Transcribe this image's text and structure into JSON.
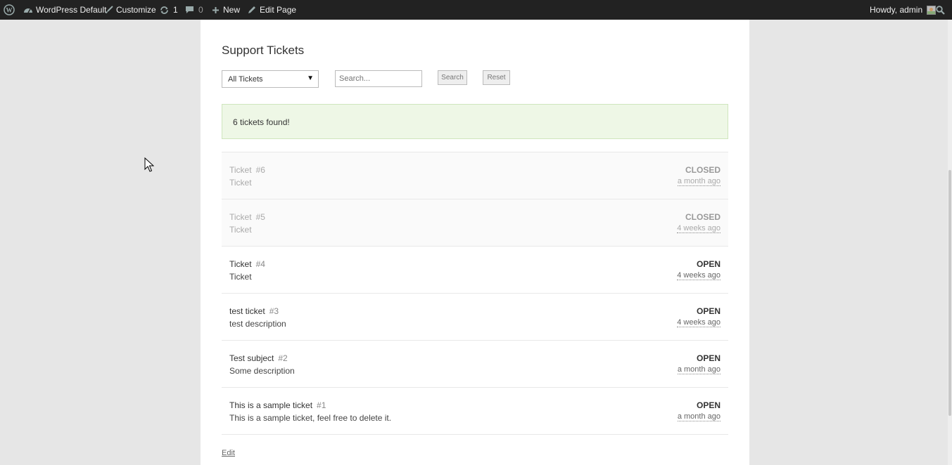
{
  "adminbar": {
    "site_name": "WordPress Default",
    "customize": "Customize",
    "updates_count": "1",
    "comments_count": "0",
    "new_label": "New",
    "edit_page": "Edit Page",
    "howdy": "Howdy, admin"
  },
  "page": {
    "title": "Support Tickets",
    "filter_selected": "All Tickets",
    "search_placeholder": "Search...",
    "search_button": "Search",
    "reset_button": "Reset",
    "notice": "6 tickets found!",
    "edit_link": "Edit"
  },
  "tickets": [
    {
      "subject": "Ticket",
      "number": "#6",
      "description": "Ticket",
      "status": "CLOSED",
      "time": "a month ago"
    },
    {
      "subject": "Ticket",
      "number": "#5",
      "description": "Ticket",
      "status": "CLOSED",
      "time": "4 weeks ago"
    },
    {
      "subject": "Ticket",
      "number": "#4",
      "description": "Ticket",
      "status": "OPEN",
      "time": "4 weeks ago"
    },
    {
      "subject": "test ticket",
      "number": "#3",
      "description": "test description",
      "status": "OPEN",
      "time": "4 weeks ago"
    },
    {
      "subject": "Test subject",
      "number": "#2",
      "description": "Some description",
      "status": "OPEN",
      "time": "a month ago"
    },
    {
      "subject": "This is a sample ticket",
      "number": "#1",
      "description": "This is a sample ticket, feel free to delete it.",
      "status": "OPEN",
      "time": "a month ago"
    }
  ],
  "icons": [
    "wordpress-icon",
    "dashboard-icon",
    "brush-icon",
    "updates-icon",
    "comment-icon",
    "plus-icon",
    "pencil-icon",
    "avatar",
    "search-icon",
    "mouse-cursor-icon"
  ]
}
